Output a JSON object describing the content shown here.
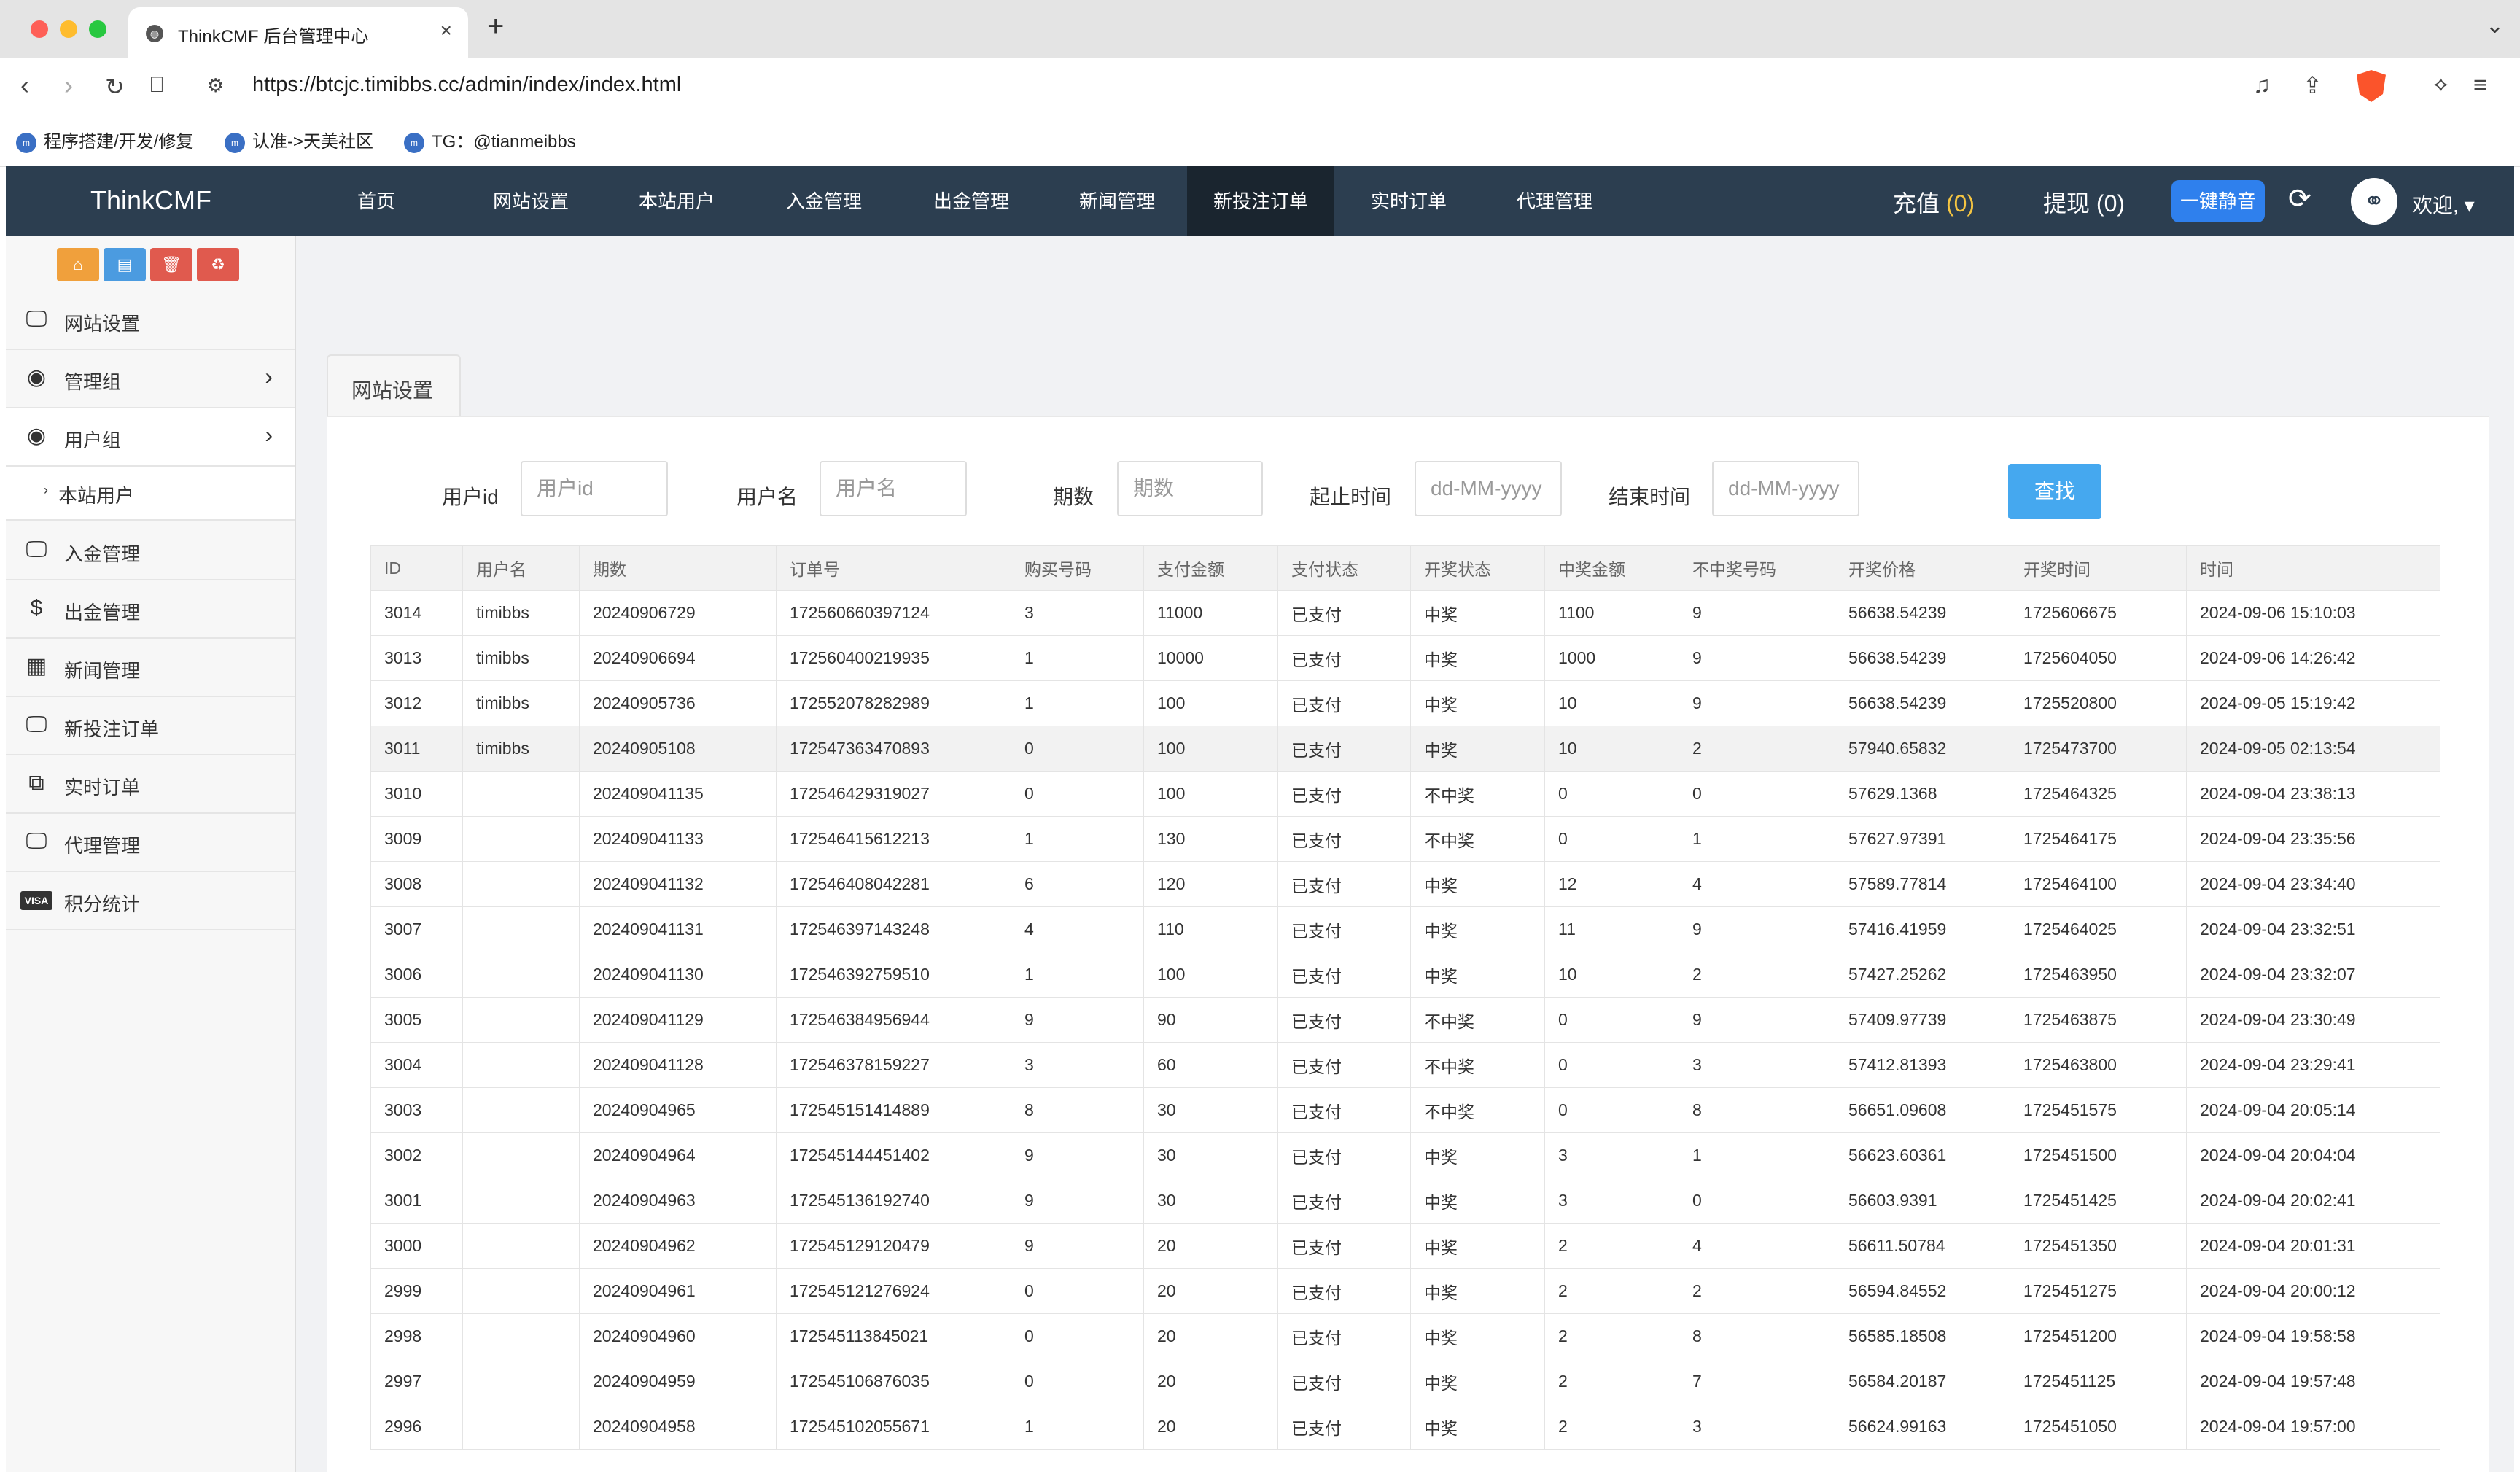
{
  "browser": {
    "tab_title": "ThinkCMF 后台管理中心",
    "url": "https://btcjc.timibbs.cc/admin/index/index.html",
    "bookmarks": [
      "程序搭建/开发/修复",
      "认准->天美社区",
      "TG：@tianmeibbs"
    ]
  },
  "app": {
    "brand": "ThinkCMF",
    "nav": [
      "首页",
      "网站设置",
      "本站用户",
      "入金管理",
      "出金管理",
      "新闻管理",
      "新投注订单",
      "实时订单",
      "代理管理"
    ],
    "active_nav": "新投注订单",
    "recharge_label": "充值",
    "recharge_count": "(0)",
    "withdraw_label": "提现",
    "withdraw_count": "(0)",
    "mute_label": "一键静音",
    "welcome": "欢迎,",
    "colors": {
      "topbar": "#2c3e50",
      "accent": "#2f80ed",
      "search": "#45a8ef"
    }
  },
  "sidebar": {
    "quick_buttons": [
      {
        "icon": "home-icon",
        "color": "#f0a03c"
      },
      {
        "icon": "file-icon",
        "color": "#4b9be0"
      },
      {
        "icon": "trash-icon",
        "color": "#e05a4e"
      },
      {
        "icon": "recycle-icon",
        "color": "#e05a4e"
      }
    ],
    "items": [
      {
        "label": "网站设置",
        "icon": "monitor-icon"
      },
      {
        "label": "管理组",
        "icon": "user-circle-icon",
        "arrow": true
      },
      {
        "label": "用户组",
        "icon": "user-circle-icon",
        "arrow": true
      },
      {
        "label": "入金管理",
        "icon": "monitor-icon"
      },
      {
        "label": "出金管理",
        "icon": "dollar-icon"
      },
      {
        "label": "新闻管理",
        "icon": "newspaper-icon"
      },
      {
        "label": "新投注订单",
        "icon": "monitor-icon"
      },
      {
        "label": "实时订单",
        "icon": "windows-icon"
      },
      {
        "label": "代理管理",
        "icon": "monitor-icon"
      },
      {
        "label": "积分统计",
        "icon": "visa-icon"
      }
    ],
    "sub_item": "本站用户"
  },
  "panel": {
    "tab": "网站设置",
    "filters": [
      {
        "label": "用户id",
        "placeholder": "用户id"
      },
      {
        "label": "用户名",
        "placeholder": "用户名"
      },
      {
        "label": "期数",
        "placeholder": "期数"
      },
      {
        "label": "起止时间",
        "placeholder": "dd-MM-yyyy"
      },
      {
        "label": "结束时间",
        "placeholder": "dd-MM-yyyy"
      }
    ],
    "search_label": "查找"
  },
  "table": {
    "columns": [
      "ID",
      "用户名",
      "期数",
      "订单号",
      "购买号码",
      "支付金额",
      "支付状态",
      "开奖状态",
      "中奖金额",
      "不中奖号码",
      "开奖价格",
      "开奖时间",
      "时间"
    ],
    "rows": [
      [
        "3014",
        "timibbs",
        "20240906729",
        "172560660397124",
        "3",
        "11000",
        "已支付",
        "中奖",
        "1100",
        "9",
        "56638.54239",
        "1725606675",
        "2024-09-06 15:10:03"
      ],
      [
        "3013",
        "timibbs",
        "20240906694",
        "172560400219935",
        "1",
        "10000",
        "已支付",
        "中奖",
        "1000",
        "9",
        "56638.54239",
        "1725604050",
        "2024-09-06 14:26:42"
      ],
      [
        "3012",
        "timibbs",
        "20240905736",
        "172552078282989",
        "1",
        "100",
        "已支付",
        "中奖",
        "10",
        "9",
        "56638.54239",
        "1725520800",
        "2024-09-05 15:19:42"
      ],
      [
        "3011",
        "timibbs",
        "20240905108",
        "172547363470893",
        "0",
        "100",
        "已支付",
        "中奖",
        "10",
        "2",
        "57940.65832",
        "1725473700",
        "2024-09-05 02:13:54"
      ],
      [
        "3010",
        "",
        "202409041135",
        "172546429319027",
        "0",
        "100",
        "已支付",
        "不中奖",
        "0",
        "0",
        "57629.1368",
        "1725464325",
        "2024-09-04 23:38:13"
      ],
      [
        "3009",
        "",
        "202409041133",
        "172546415612213",
        "1",
        "130",
        "已支付",
        "不中奖",
        "0",
        "1",
        "57627.97391",
        "1725464175",
        "2024-09-04 23:35:56"
      ],
      [
        "3008",
        "",
        "202409041132",
        "172546408042281",
        "6",
        "120",
        "已支付",
        "中奖",
        "12",
        "4",
        "57589.77814",
        "1725464100",
        "2024-09-04 23:34:40"
      ],
      [
        "3007",
        "",
        "202409041131",
        "172546397143248",
        "4",
        "110",
        "已支付",
        "中奖",
        "11",
        "9",
        "57416.41959",
        "1725464025",
        "2024-09-04 23:32:51"
      ],
      [
        "3006",
        "",
        "202409041130",
        "172546392759510",
        "1",
        "100",
        "已支付",
        "中奖",
        "10",
        "2",
        "57427.25262",
        "1725463950",
        "2024-09-04 23:32:07"
      ],
      [
        "3005",
        "",
        "202409041129",
        "172546384956944",
        "9",
        "90",
        "已支付",
        "不中奖",
        "0",
        "9",
        "57409.97739",
        "1725463875",
        "2024-09-04 23:30:49"
      ],
      [
        "3004",
        "",
        "202409041128",
        "172546378159227",
        "3",
        "60",
        "已支付",
        "不中奖",
        "0",
        "3",
        "57412.81393",
        "1725463800",
        "2024-09-04 23:29:41"
      ],
      [
        "3003",
        "",
        "20240904965",
        "172545151414889",
        "8",
        "30",
        "已支付",
        "不中奖",
        "0",
        "8",
        "56651.09608",
        "1725451575",
        "2024-09-04 20:05:14"
      ],
      [
        "3002",
        "",
        "20240904964",
        "172545144451402",
        "9",
        "30",
        "已支付",
        "中奖",
        "3",
        "1",
        "56623.60361",
        "1725451500",
        "2024-09-04 20:04:04"
      ],
      [
        "3001",
        "",
        "20240904963",
        "172545136192740",
        "9",
        "30",
        "已支付",
        "中奖",
        "3",
        "0",
        "56603.9391",
        "1725451425",
        "2024-09-04 20:02:41"
      ],
      [
        "3000",
        "",
        "20240904962",
        "172545129120479",
        "9",
        "20",
        "已支付",
        "中奖",
        "2",
        "4",
        "56611.50784",
        "1725451350",
        "2024-09-04 20:01:31"
      ],
      [
        "2999",
        "",
        "20240904961",
        "172545121276924",
        "0",
        "20",
        "已支付",
        "中奖",
        "2",
        "2",
        "56594.84552",
        "1725451275",
        "2024-09-04 20:00:12"
      ],
      [
        "2998",
        "",
        "20240904960",
        "172545113845021",
        "0",
        "20",
        "已支付",
        "中奖",
        "2",
        "8",
        "56585.18508",
        "1725451200",
        "2024-09-04 19:58:58"
      ],
      [
        "2997",
        "",
        "20240904959",
        "172545106876035",
        "0",
        "20",
        "已支付",
        "中奖",
        "2",
        "7",
        "56584.20187",
        "1725451125",
        "2024-09-04 19:57:48"
      ],
      [
        "2996",
        "",
        "20240904958",
        "172545102055671",
        "1",
        "20",
        "已支付",
        "中奖",
        "2",
        "3",
        "56624.99163",
        "1725451050",
        "2024-09-04 19:57:00"
      ]
    ]
  }
}
